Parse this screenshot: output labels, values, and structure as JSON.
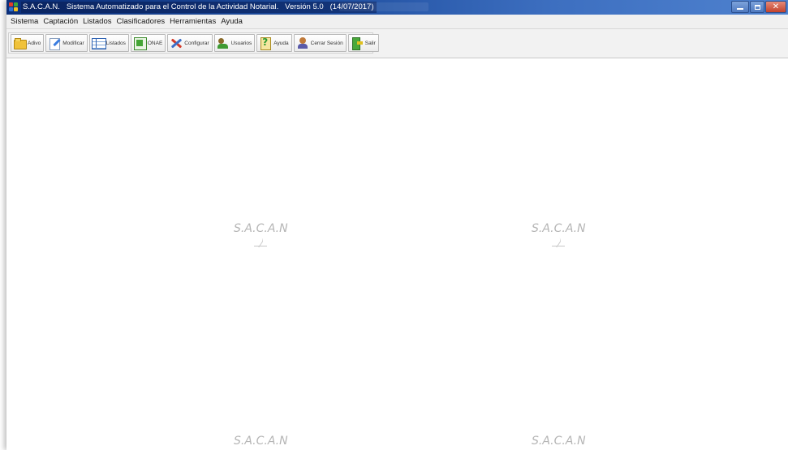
{
  "window": {
    "title": "S.A.C.A.N.   Sistema Automatizado para el Control de la Actividad Notarial.   Versión 5.0   (14/07/2017)",
    "app_icon": "sacan-app-icon",
    "controls": [
      "minimize-icon",
      "maximize-icon",
      "close-icon"
    ]
  },
  "menu": {
    "items": [
      {
        "label": "Sistema"
      },
      {
        "label": "Captación"
      },
      {
        "label": "Listados"
      },
      {
        "label": "Clasificadores"
      },
      {
        "label": "Herramientas"
      },
      {
        "label": "Ayuda"
      }
    ]
  },
  "toolbar": {
    "buttons": [
      {
        "label": "Adivo",
        "icon": "folder-icon"
      },
      {
        "label": "Modificar",
        "icon": "edit-pencil-icon"
      },
      {
        "label": "Listados",
        "icon": "table-icon"
      },
      {
        "label": "ONAE",
        "icon": "onae-icon"
      },
      {
        "label": "Configurar",
        "icon": "tools-icon"
      },
      {
        "label": "Usuarios",
        "icon": "users-icon"
      },
      {
        "label": "Ayuda",
        "icon": "help-icon"
      },
      {
        "label": "Cerrar Sesión",
        "icon": "logout-icon"
      },
      {
        "label": "Salir",
        "icon": "exit-icon"
      }
    ]
  },
  "workspace": {
    "watermark_text": "S.A.C.A.N",
    "watermark_icon": "quill-icon"
  },
  "colors": {
    "titlebar": "#1f4e9f",
    "menubar": "#f0f0f0",
    "toolbar": "#f2f2f2",
    "watermark": "#b5b5b5",
    "close_button": "#c2422c"
  }
}
